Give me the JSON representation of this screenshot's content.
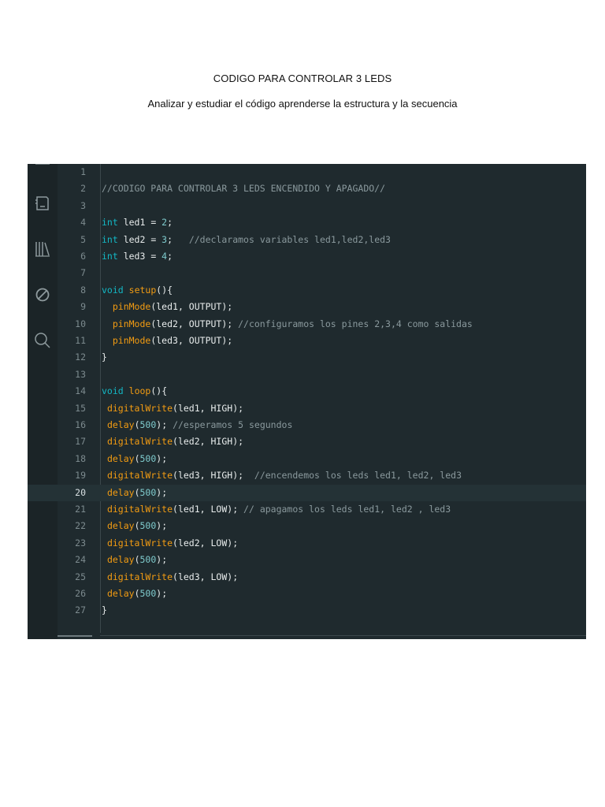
{
  "document": {
    "title": "CODIGO PARA CONTROLAR 3 LEDS",
    "subtitle": "Analizar y estudiar el código aprenderse la estructura y la secuencia"
  },
  "editor": {
    "active_line": 20,
    "colors": {
      "background": "#1f2a2e",
      "comment": "#8a999d",
      "type_keyword": "#13b8c5",
      "function": "#f39c12",
      "number": "#7fcbcd",
      "plain": "#e8ecec"
    },
    "activity_icons": [
      "folder-icon",
      "board-icon",
      "library-icon",
      "debug-icon",
      "search-icon"
    ],
    "lines": [
      {
        "n": "1",
        "tokens": []
      },
      {
        "n": "2",
        "tokens": [
          {
            "t": "comment",
            "v": "//CODIGO PARA CONTROLAR 3 LEDS ENCENDIDO Y APAGADO//"
          }
        ]
      },
      {
        "n": "3",
        "tokens": []
      },
      {
        "n": "4",
        "tokens": [
          {
            "t": "type",
            "v": "int"
          },
          {
            "t": "plain",
            "v": " led1 = "
          },
          {
            "t": "num",
            "v": "2"
          },
          {
            "t": "plain",
            "v": ";"
          }
        ]
      },
      {
        "n": "5",
        "tokens": [
          {
            "t": "type",
            "v": "int"
          },
          {
            "t": "plain",
            "v": " led2 = "
          },
          {
            "t": "num",
            "v": "3"
          },
          {
            "t": "plain",
            "v": ";   "
          },
          {
            "t": "comment",
            "v": "//declaramos variables led1,led2,led3"
          }
        ]
      },
      {
        "n": "6",
        "tokens": [
          {
            "t": "type",
            "v": "int"
          },
          {
            "t": "plain",
            "v": " led3 = "
          },
          {
            "t": "num",
            "v": "4"
          },
          {
            "t": "plain",
            "v": ";"
          }
        ]
      },
      {
        "n": "7",
        "tokens": []
      },
      {
        "n": "8",
        "tokens": [
          {
            "t": "type",
            "v": "void"
          },
          {
            "t": "plain",
            "v": " "
          },
          {
            "t": "fn",
            "v": "setup"
          },
          {
            "t": "plain",
            "v": "(){"
          }
        ]
      },
      {
        "n": "9",
        "tokens": [
          {
            "t": "plain",
            "v": "  "
          },
          {
            "t": "fn",
            "v": "pinMode"
          },
          {
            "t": "plain",
            "v": "(led1, OUTPUT);"
          }
        ]
      },
      {
        "n": "10",
        "tokens": [
          {
            "t": "plain",
            "v": "  "
          },
          {
            "t": "fn",
            "v": "pinMode"
          },
          {
            "t": "plain",
            "v": "(led2, OUTPUT); "
          },
          {
            "t": "comment",
            "v": "//configuramos los pines 2,3,4 como salidas"
          }
        ]
      },
      {
        "n": "11",
        "tokens": [
          {
            "t": "plain",
            "v": "  "
          },
          {
            "t": "fn",
            "v": "pinMode"
          },
          {
            "t": "plain",
            "v": "(led3, OUTPUT);"
          }
        ]
      },
      {
        "n": "12",
        "tokens": [
          {
            "t": "plain",
            "v": "}"
          }
        ]
      },
      {
        "n": "13",
        "tokens": []
      },
      {
        "n": "14",
        "tokens": [
          {
            "t": "type",
            "v": "void"
          },
          {
            "t": "plain",
            "v": " "
          },
          {
            "t": "fn",
            "v": "loop"
          },
          {
            "t": "plain",
            "v": "(){"
          }
        ]
      },
      {
        "n": "15",
        "tokens": [
          {
            "t": "plain",
            "v": " "
          },
          {
            "t": "fn",
            "v": "digitalWrite"
          },
          {
            "t": "plain",
            "v": "(led1, HIGH);"
          }
        ]
      },
      {
        "n": "16",
        "tokens": [
          {
            "t": "plain",
            "v": " "
          },
          {
            "t": "fn",
            "v": "delay"
          },
          {
            "t": "plain",
            "v": "("
          },
          {
            "t": "num",
            "v": "500"
          },
          {
            "t": "plain",
            "v": "); "
          },
          {
            "t": "comment",
            "v": "//esperamos 5 segundos"
          }
        ]
      },
      {
        "n": "17",
        "tokens": [
          {
            "t": "plain",
            "v": " "
          },
          {
            "t": "fn",
            "v": "digitalWrite"
          },
          {
            "t": "plain",
            "v": "(led2, HIGH);"
          }
        ]
      },
      {
        "n": "18",
        "tokens": [
          {
            "t": "plain",
            "v": " "
          },
          {
            "t": "fn",
            "v": "delay"
          },
          {
            "t": "plain",
            "v": "("
          },
          {
            "t": "num",
            "v": "500"
          },
          {
            "t": "plain",
            "v": ");"
          }
        ]
      },
      {
        "n": "19",
        "tokens": [
          {
            "t": "plain",
            "v": " "
          },
          {
            "t": "fn",
            "v": "digitalWrite"
          },
          {
            "t": "plain",
            "v": "(led3, HIGH);  "
          },
          {
            "t": "comment",
            "v": "//encendemos los leds led1, led2, led3"
          }
        ]
      },
      {
        "n": "20",
        "tokens": [
          {
            "t": "plain",
            "v": " "
          },
          {
            "t": "fn",
            "v": "delay"
          },
          {
            "t": "plain",
            "v": "("
          },
          {
            "t": "num",
            "v": "500"
          },
          {
            "t": "plain",
            "v": ");"
          }
        ]
      },
      {
        "n": "21",
        "tokens": [
          {
            "t": "plain",
            "v": " "
          },
          {
            "t": "fn",
            "v": "digitalWrite"
          },
          {
            "t": "plain",
            "v": "(led1, LOW); "
          },
          {
            "t": "comment",
            "v": "// apagamos los leds led1, led2 , led3"
          }
        ]
      },
      {
        "n": "22",
        "tokens": [
          {
            "t": "plain",
            "v": " "
          },
          {
            "t": "fn",
            "v": "delay"
          },
          {
            "t": "plain",
            "v": "("
          },
          {
            "t": "num",
            "v": "500"
          },
          {
            "t": "plain",
            "v": ");"
          }
        ]
      },
      {
        "n": "23",
        "tokens": [
          {
            "t": "plain",
            "v": " "
          },
          {
            "t": "fn",
            "v": "digitalWrite"
          },
          {
            "t": "plain",
            "v": "(led2, LOW);"
          }
        ]
      },
      {
        "n": "24",
        "tokens": [
          {
            "t": "plain",
            "v": " "
          },
          {
            "t": "fn",
            "v": "delay"
          },
          {
            "t": "plain",
            "v": "("
          },
          {
            "t": "num",
            "v": "500"
          },
          {
            "t": "plain",
            "v": ");"
          }
        ]
      },
      {
        "n": "25",
        "tokens": [
          {
            "t": "plain",
            "v": " "
          },
          {
            "t": "fn",
            "v": "digitalWrite"
          },
          {
            "t": "plain",
            "v": "(led3, LOW);"
          }
        ]
      },
      {
        "n": "26",
        "tokens": [
          {
            "t": "plain",
            "v": " "
          },
          {
            "t": "fn",
            "v": "delay"
          },
          {
            "t": "plain",
            "v": "("
          },
          {
            "t": "num",
            "v": "500"
          },
          {
            "t": "plain",
            "v": ");"
          }
        ]
      },
      {
        "n": "27",
        "tokens": [
          {
            "t": "plain",
            "v": "}"
          }
        ]
      }
    ]
  }
}
